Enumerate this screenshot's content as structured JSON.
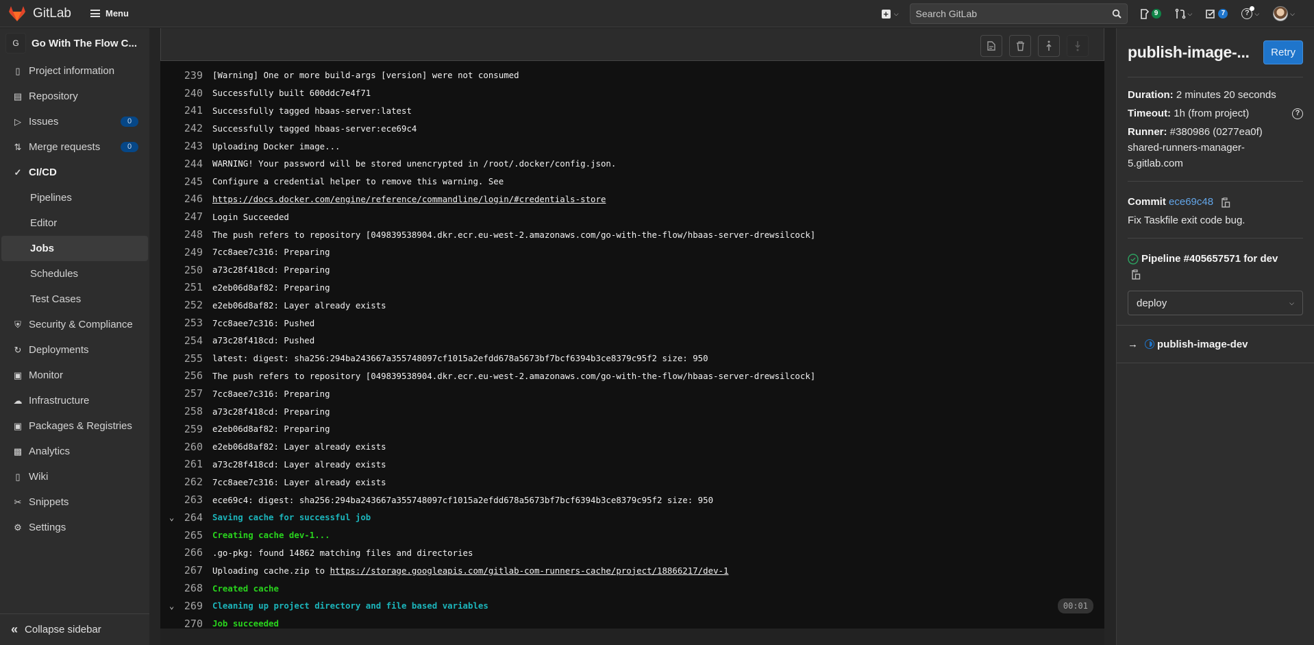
{
  "topbar": {
    "brand": "GitLab",
    "menu_label": "Menu",
    "search_placeholder": "Search GitLab",
    "issues_count": "9",
    "todos_count": "7",
    "colors": {
      "issues_badge": "#108548",
      "todos_badge": "#1f75cb"
    }
  },
  "sidebar": {
    "project_initial": "G",
    "project_name": "Go With The Flow C...",
    "items": [
      {
        "label": "Project information",
        "icon": "project-info-icon",
        "type": "main"
      },
      {
        "label": "Repository",
        "icon": "repository-icon",
        "type": "main"
      },
      {
        "label": "Issues",
        "icon": "issues-icon",
        "type": "main",
        "badge": "0"
      },
      {
        "label": "Merge requests",
        "icon": "merge-request-icon",
        "type": "main",
        "badge": "0"
      },
      {
        "label": "CI/CD",
        "icon": "rocket-icon",
        "type": "main",
        "bold": true
      },
      {
        "label": "Pipelines",
        "type": "sub"
      },
      {
        "label": "Editor",
        "type": "sub"
      },
      {
        "label": "Jobs",
        "type": "sub",
        "active": true
      },
      {
        "label": "Schedules",
        "type": "sub"
      },
      {
        "label": "Test Cases",
        "type": "sub"
      },
      {
        "label": "Security & Compliance",
        "icon": "shield-icon",
        "type": "main"
      },
      {
        "label": "Deployments",
        "icon": "deployments-icon",
        "type": "main"
      },
      {
        "label": "Monitor",
        "icon": "monitor-icon",
        "type": "main"
      },
      {
        "label": "Infrastructure",
        "icon": "cloud-icon",
        "type": "main"
      },
      {
        "label": "Packages & Registries",
        "icon": "package-icon",
        "type": "main"
      },
      {
        "label": "Analytics",
        "icon": "chart-icon",
        "type": "main"
      },
      {
        "label": "Wiki",
        "icon": "book-icon",
        "type": "main"
      },
      {
        "label": "Snippets",
        "icon": "scissors-icon",
        "type": "main"
      },
      {
        "label": "Settings",
        "icon": "gear-icon",
        "type": "main"
      }
    ],
    "collapse_label": "Collapse sidebar"
  },
  "log": {
    "toolbar": [
      "show-raw-button",
      "erase-log-button",
      "scroll-top-button",
      "scroll-bottom-button"
    ],
    "lines": [
      {
        "n": "239",
        "text": "[Warning] One or more build-args [version] were not consumed"
      },
      {
        "n": "240",
        "text": "Successfully built 600ddc7e4f71"
      },
      {
        "n": "241",
        "text": "Successfully tagged hbaas-server:latest"
      },
      {
        "n": "242",
        "text": "Successfully tagged hbaas-server:ece69c4"
      },
      {
        "n": "243",
        "text": "Uploading Docker image..."
      },
      {
        "n": "244",
        "text": "WARNING! Your password will be stored unencrypted in /root/.docker/config.json."
      },
      {
        "n": "245",
        "text": "Configure a credential helper to remove this warning. See"
      },
      {
        "n": "246",
        "text": "",
        "link": "https://docs.docker.com/engine/reference/commandline/login/#credentials-store"
      },
      {
        "n": "247",
        "text": "Login Succeeded"
      },
      {
        "n": "248",
        "text": "The push refers to repository [049839538904.dkr.ecr.eu-west-2.amazonaws.com/go-with-the-flow/hbaas-server-drewsilcock]"
      },
      {
        "n": "249",
        "text": "7cc8aee7c316: Preparing"
      },
      {
        "n": "250",
        "text": "a73c28f418cd: Preparing"
      },
      {
        "n": "251",
        "text": "e2eb06d8af82: Preparing"
      },
      {
        "n": "252",
        "text": "e2eb06d8af82: Layer already exists"
      },
      {
        "n": "253",
        "text": "7cc8aee7c316: Pushed"
      },
      {
        "n": "254",
        "text": "a73c28f418cd: Pushed"
      },
      {
        "n": "255",
        "text": "latest: digest: sha256:294ba243667a355748097cf1015a2efdd678a5673bf7bcf6394b3ce8379c95f2 size: 950"
      },
      {
        "n": "256",
        "text": "The push refers to repository [049839538904.dkr.ecr.eu-west-2.amazonaws.com/go-with-the-flow/hbaas-server-drewsilcock]"
      },
      {
        "n": "257",
        "text": "7cc8aee7c316: Preparing"
      },
      {
        "n": "258",
        "text": "a73c28f418cd: Preparing"
      },
      {
        "n": "259",
        "text": "e2eb06d8af82: Preparing"
      },
      {
        "n": "260",
        "text": "e2eb06d8af82: Layer already exists"
      },
      {
        "n": "261",
        "text": "a73c28f418cd: Layer already exists"
      },
      {
        "n": "262",
        "text": "7cc8aee7c316: Layer already exists"
      },
      {
        "n": "263",
        "text": "ece69c4: digest: sha256:294ba243667a355748097cf1015a2efdd678a5673bf7bcf6394b3ce8379c95f2 size: 950"
      },
      {
        "n": "264",
        "text": "Saving cache for successful job",
        "style": "section",
        "collapsible": true
      },
      {
        "n": "265",
        "text": "Creating cache dev-1...",
        "style": "green"
      },
      {
        "n": "266",
        "text": ".go-pkg: found 14862 matching files and directories"
      },
      {
        "n": "267",
        "text": "Uploading cache.zip to ",
        "link": "https://storage.googleapis.com/gitlab-com-runners-cache/project/18866217/dev-1"
      },
      {
        "n": "268",
        "text": "Created cache",
        "style": "green"
      },
      {
        "n": "269",
        "text": "Cleaning up project directory and file based variables",
        "style": "section",
        "collapsible": true,
        "duration": "00:01"
      },
      {
        "n": "270",
        "text": "Job succeeded",
        "style": "green"
      }
    ]
  },
  "job": {
    "title": "publish-image-...",
    "retry_label": "Retry",
    "duration_label": "Duration:",
    "duration": "2 minutes 20 seconds",
    "timeout_label": "Timeout:",
    "timeout": "1h (from project)",
    "runner_label": "Runner:",
    "runner": "#380986 (0277ea0f)",
    "runner_host": "shared-runners-manager-5.gitlab.com",
    "commit_label": "Commit",
    "commit_sha": "ece69c48",
    "commit_message": "Fix Taskfile exit code bug.",
    "pipeline_label": "Pipeline #405657571 for dev",
    "stage": "deploy",
    "current_job": "publish-image-dev",
    "colors": {
      "retry": "#1f75cb",
      "commit_link": "#63a6e9",
      "pipeline_success": "#2da160"
    }
  }
}
